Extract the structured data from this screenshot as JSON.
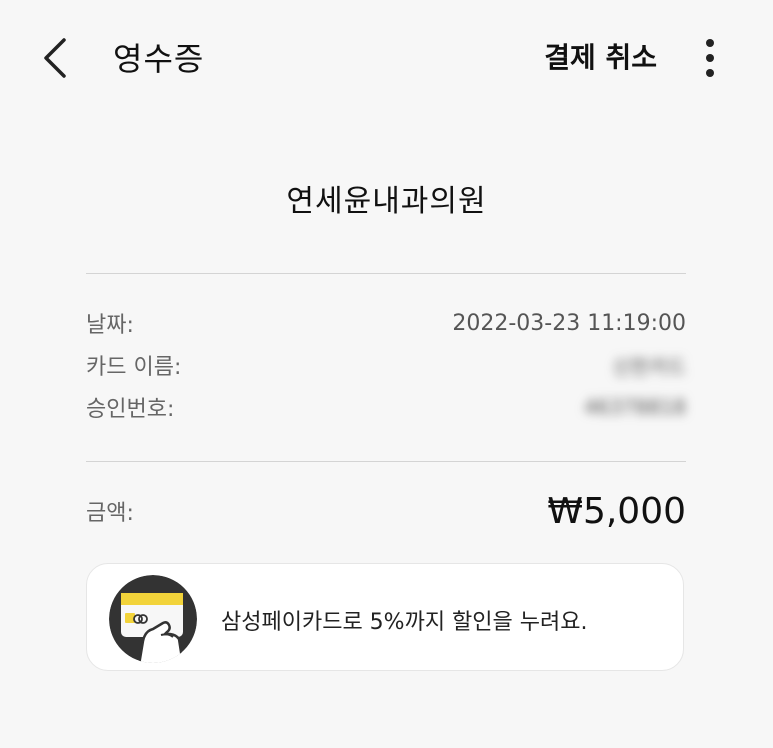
{
  "header": {
    "title": "영수증",
    "cancel_label": "결제 취소"
  },
  "merchant": {
    "name": "연세윤내과의원"
  },
  "details": [
    {
      "label": "날짜:",
      "value": "2022-03-23 11:19:00"
    },
    {
      "label": "카드 이름:",
      "value": "신한카드"
    },
    {
      "label": "승인번호:",
      "value": "46378818"
    }
  ],
  "amount": {
    "label": "금액:",
    "value": "₩5,000"
  },
  "promo": {
    "text": "삼성페이카드로 5%까지 할인을 누려요."
  },
  "colors": {
    "background": "#f7f7f7",
    "promo_icon_bg": "#333333",
    "promo_card": "#f2d33a"
  }
}
